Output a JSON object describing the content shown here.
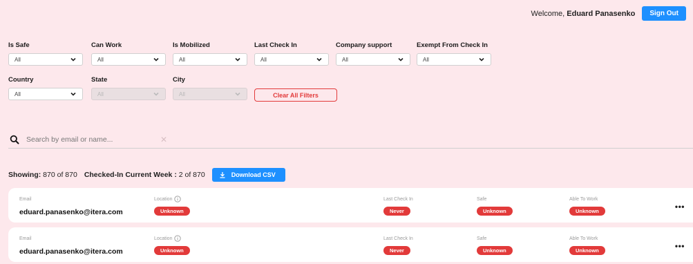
{
  "header": {
    "welcome_prefix": "Welcome, ",
    "user_name": "Eduard Panasenko",
    "sign_out_label": "Sign Out"
  },
  "filters": {
    "is_safe": {
      "label": "Is Safe",
      "value": "All"
    },
    "can_work": {
      "label": "Can Work",
      "value": "All"
    },
    "is_mobilized": {
      "label": "Is Mobilized",
      "value": "All"
    },
    "last_check_in": {
      "label": "Last Check In",
      "value": "All"
    },
    "company_support": {
      "label": "Company support",
      "value": "All"
    },
    "exempt": {
      "label": "Exempt From Check In",
      "value": "All"
    },
    "country": {
      "label": "Country",
      "value": "All"
    },
    "state": {
      "label": "State",
      "value": "All"
    },
    "city": {
      "label": "City",
      "value": "All"
    },
    "clear_label": "Clear All Filters"
  },
  "search": {
    "placeholder": "Search by email or name...",
    "clear_glyph": "✕"
  },
  "summary": {
    "showing_label": "Showing:",
    "showing_value": "870 of 870",
    "checked_label": "Checked-In Current Week :",
    "checked_value": "2 of 870",
    "download_label": "Download CSV"
  },
  "columns": {
    "email": "Email",
    "location": "Location",
    "last_check_in": "Last Check In",
    "safe": "Safe",
    "able_to_work": "Able To Work"
  },
  "rows": [
    {
      "email": "eduard.panasenko@itera.com",
      "location": "Unknown",
      "last_check_in": "Never",
      "safe": "Unknown",
      "able_to_work": "Unknown"
    },
    {
      "email": "eduard.panasenko@itera.com",
      "location": "Unknown",
      "last_check_in": "Never",
      "safe": "Unknown",
      "able_to_work": "Unknown"
    }
  ],
  "colors": {
    "background": "#fde8ec",
    "accent_blue": "#1e90ff",
    "status_red": "#e23a3a"
  }
}
